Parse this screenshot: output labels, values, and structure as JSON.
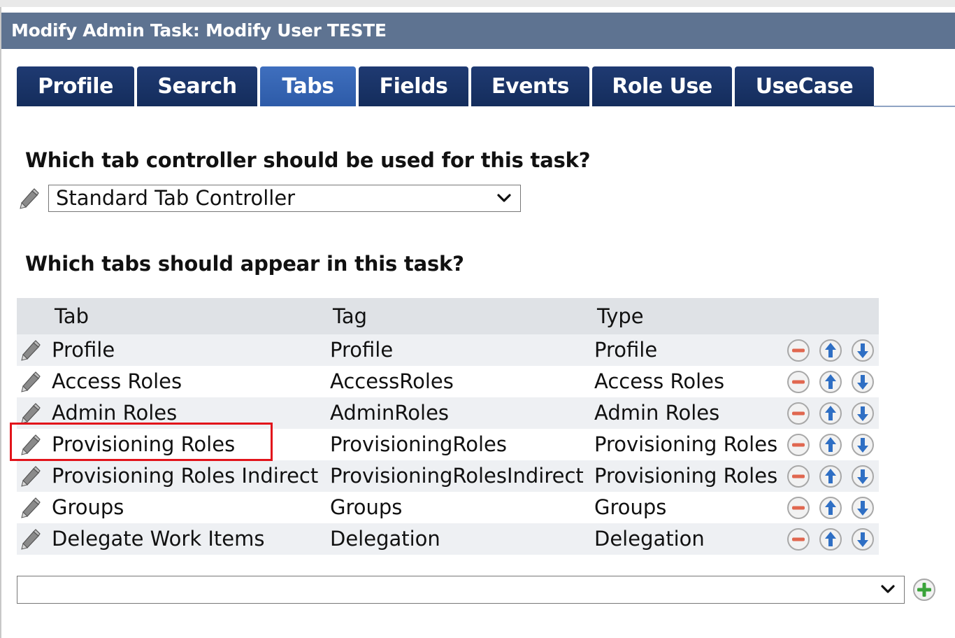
{
  "title": "Modify Admin Task: Modify User TESTE",
  "tabs": [
    {
      "label": "Profile",
      "active": false
    },
    {
      "label": "Search",
      "active": false
    },
    {
      "label": "Tabs",
      "active": true
    },
    {
      "label": "Fields",
      "active": false
    },
    {
      "label": "Events",
      "active": false
    },
    {
      "label": "Role Use",
      "active": false
    },
    {
      "label": "UseCase",
      "active": false
    }
  ],
  "controller": {
    "question": "Which tab controller should be used for this task?",
    "selected": "Standard Tab Controller"
  },
  "tablist": {
    "question": "Which tabs should appear in this task?",
    "headers": {
      "tab": "Tab",
      "tag": "Tag",
      "type": "Type"
    },
    "rows": [
      {
        "tab": "Profile",
        "tag": "Profile",
        "type": "Profile"
      },
      {
        "tab": "Access Roles",
        "tag": "AccessRoles",
        "type": "Access Roles"
      },
      {
        "tab": "Admin Roles",
        "tag": "AdminRoles",
        "type": "Admin Roles"
      },
      {
        "tab": "Provisioning Roles",
        "tag": "ProvisioningRoles",
        "type": "Provisioning Roles"
      },
      {
        "tab": "Provisioning Roles Indirect",
        "tag": "ProvisioningRolesIndirect",
        "type": "Provisioning Roles"
      },
      {
        "tab": "Groups",
        "tag": "Groups",
        "type": "Groups"
      },
      {
        "tab": "Delegate Work Items",
        "tag": "Delegation",
        "type": "Delegation"
      }
    ],
    "highlighted_row": "Provisioning Roles"
  },
  "add_tab": {
    "selected": ""
  },
  "icons": {
    "edit": "pencil-icon",
    "remove": "remove-icon",
    "move_up": "arrow-up-icon",
    "move_down": "arrow-down-icon",
    "add": "add-icon",
    "dropdown": "chevron-down-icon"
  },
  "colors": {
    "title_bar": "#5e7391",
    "tab_inactive": "#142d5c",
    "tab_active": "#2d5ba8",
    "highlight_box": "#e2141b",
    "remove_icon": "#e0674f",
    "arrow_icon": "#2f6fc4",
    "add_icon": "#3aa33a"
  }
}
